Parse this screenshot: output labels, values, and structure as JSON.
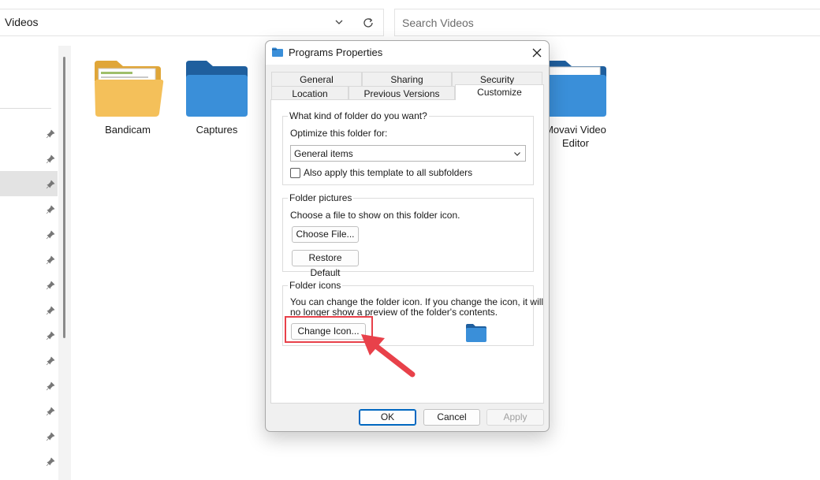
{
  "explorer": {
    "address_text": "Videos",
    "search_placeholder": "Search Videos",
    "files": [
      {
        "name": "Bandicam"
      },
      {
        "name": "Captures"
      },
      {
        "name": "Movavi Video Editor"
      }
    ]
  },
  "dialog": {
    "title": "Programs Properties",
    "tabs_row_top": [
      "General",
      "Sharing",
      "Security"
    ],
    "tabs_row_bottom": [
      "Location",
      "Previous Versions",
      "Customize"
    ],
    "active_tab": "Customize",
    "groups": {
      "folder_type": {
        "title": "What kind of folder do you want?",
        "optimize_label": "Optimize this folder for:",
        "selected_option": "General items",
        "apply_subfolders_label": "Also apply this template to all subfolders",
        "apply_subfolders_checked": false
      },
      "folder_pictures": {
        "title": "Folder pictures",
        "description": "Choose a file to show on this folder icon.",
        "choose_file_label": "Choose File...",
        "restore_default_label": "Restore Default"
      },
      "folder_icons": {
        "title": "Folder icons",
        "description_line1": "You can change the folder icon. If you change the icon, it will",
        "description_line2": "no longer show a preview of the folder's contents.",
        "change_icon_label": "Change Icon..."
      }
    },
    "buttons": {
      "ok": "OK",
      "cancel": "Cancel",
      "apply": "Apply"
    }
  },
  "colors": {
    "folder_blue": "#3a8fd9",
    "folder_yellow": "#f4c05a",
    "accent": "#0067c0",
    "annotation_red": "#e8414a"
  }
}
